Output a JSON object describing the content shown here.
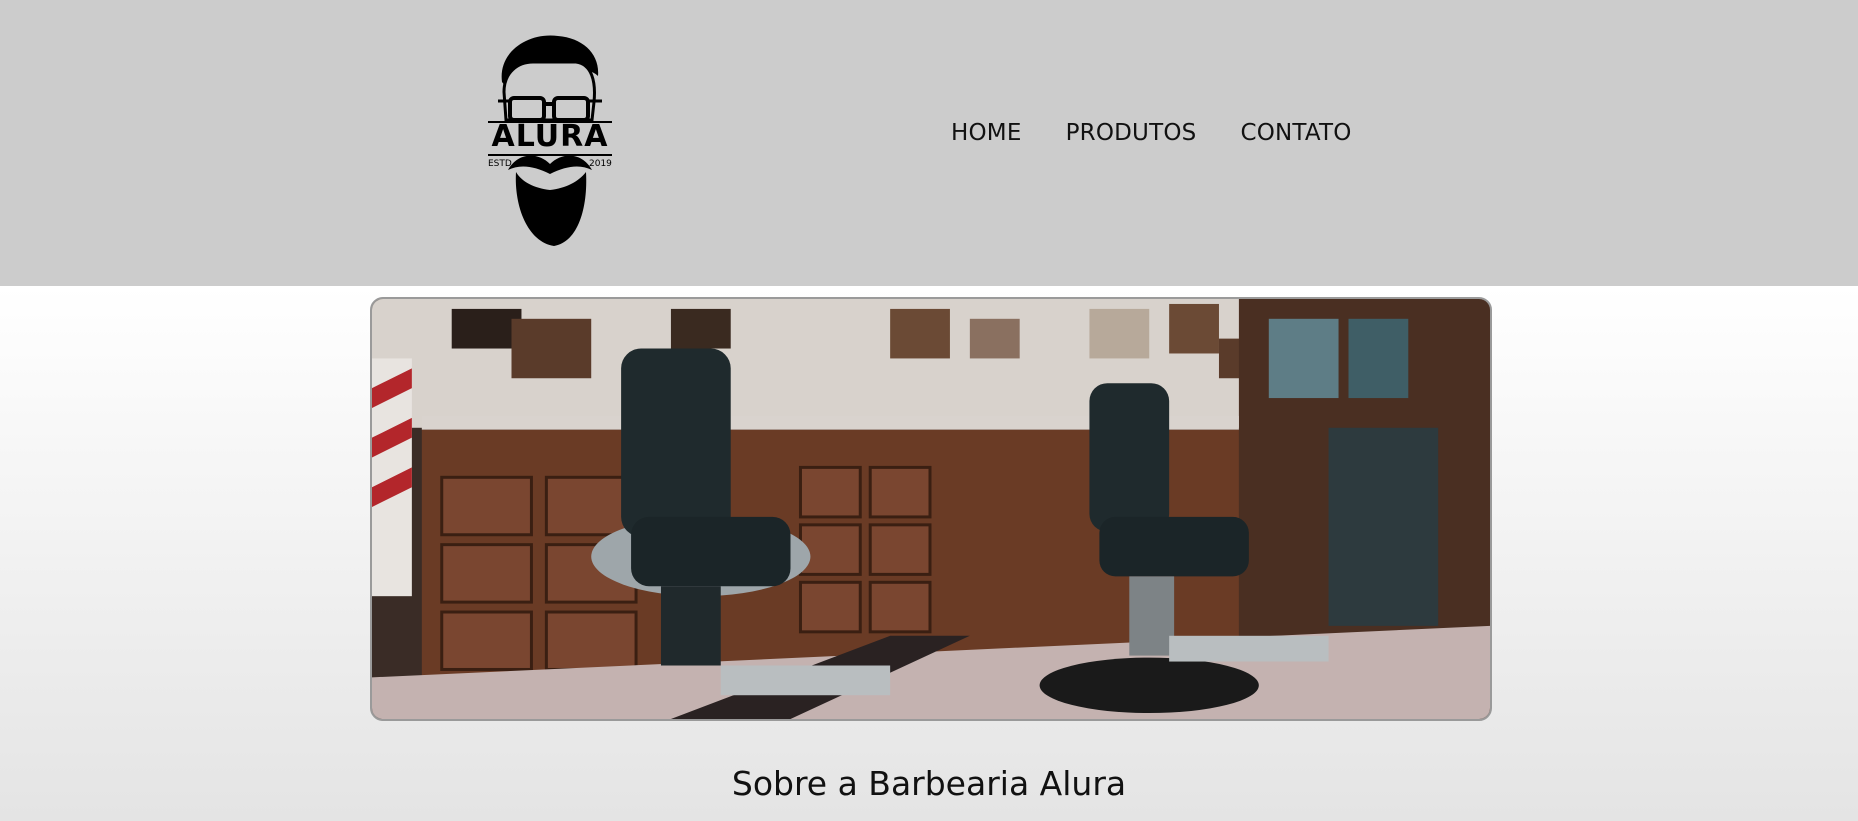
{
  "logo": {
    "name": "ALURA",
    "left_text": "ESTD",
    "right_text": "2019",
    "icon": "bearded-man-glasses-logo"
  },
  "nav": {
    "items": [
      {
        "label": "HOME"
      },
      {
        "label": "PRODUTOS"
      },
      {
        "label": "CONTATO"
      }
    ]
  },
  "banner": {
    "description_icon": "barbershop-interior-photo"
  },
  "about": {
    "title": "Sobre a Barbearia Alura"
  },
  "colors": {
    "header_bg": "#cccccc",
    "text": "#111111"
  }
}
